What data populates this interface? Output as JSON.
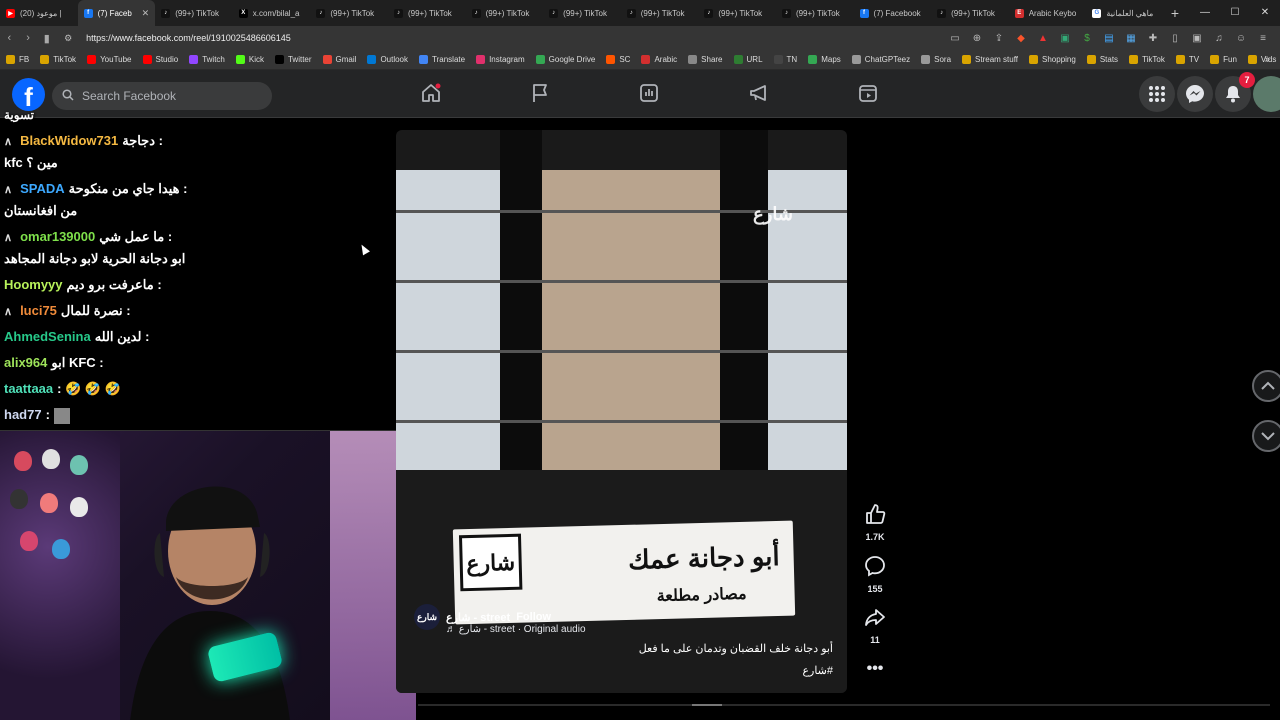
{
  "browser": {
    "tabs": [
      {
        "title": "(20) موعود |",
        "icon": "youtube-icon",
        "color": "#ff0000",
        "glyph": "▶"
      },
      {
        "title": "(7) Faceb",
        "icon": "facebook-icon",
        "color": "#1877f2",
        "glyph": "f",
        "active": true
      },
      {
        "title": "(99+) TikTok",
        "icon": "tiktok-icon",
        "color": "#111111",
        "glyph": "♪"
      },
      {
        "title": "x.com/bilal_a",
        "icon": "x-icon",
        "color": "#000000",
        "glyph": "X"
      },
      {
        "title": "(99+) TikTok",
        "icon": "tiktok-icon",
        "color": "#111111",
        "glyph": "♪"
      },
      {
        "title": "(99+) TikTok",
        "icon": "tiktok-icon",
        "color": "#111111",
        "glyph": "♪"
      },
      {
        "title": "(99+) TikTok",
        "icon": "tiktok-icon",
        "color": "#111111",
        "glyph": "♪"
      },
      {
        "title": "(99+) TikTok",
        "icon": "tiktok-icon",
        "color": "#111111",
        "glyph": "♪"
      },
      {
        "title": "(99+) TikTok",
        "icon": "tiktok-icon",
        "color": "#111111",
        "glyph": "♪"
      },
      {
        "title": "(99+) TikTok",
        "icon": "tiktok-icon",
        "color": "#111111",
        "glyph": "♪"
      },
      {
        "title": "(99+) TikTok",
        "icon": "tiktok-icon",
        "color": "#111111",
        "glyph": "♪"
      },
      {
        "title": "(7) Facebook",
        "icon": "facebook-icon",
        "color": "#1877f2",
        "glyph": "f"
      },
      {
        "title": "(99+) TikTok",
        "icon": "tiktok-icon",
        "color": "#111111",
        "glyph": "♪"
      },
      {
        "title": "Arabic Keybo",
        "icon": "arabic-keyboard-icon",
        "color": "#d32f2f",
        "glyph": "E"
      },
      {
        "title": "ماهي العلمانية",
        "icon": "google-icon",
        "color": "#ffffff",
        "glyph": "G"
      }
    ],
    "url": "https://www.facebook.com/reel/1910025486606145",
    "bookmarks": [
      {
        "label": "FB",
        "icon": "folder-icon",
        "color": "#d9a400"
      },
      {
        "label": "TikTok",
        "icon": "folder-icon",
        "color": "#d9a400"
      },
      {
        "label": "YouTube",
        "icon": "youtube-icon",
        "color": "#ff0000"
      },
      {
        "label": "Studio",
        "icon": "youtube-studio-icon",
        "color": "#ff0000"
      },
      {
        "label": "Twitch",
        "icon": "twitch-icon",
        "color": "#9146ff"
      },
      {
        "label": "Kick",
        "icon": "kick-icon",
        "color": "#53fc18"
      },
      {
        "label": "Twitter",
        "icon": "x-icon",
        "color": "#000000"
      },
      {
        "label": "Gmail",
        "icon": "gmail-icon",
        "color": "#ea4335"
      },
      {
        "label": "Outlook",
        "icon": "outlook-icon",
        "color": "#0078d4"
      },
      {
        "label": "Translate",
        "icon": "translate-icon",
        "color": "#4285f4"
      },
      {
        "label": "Instagram",
        "icon": "instagram-icon",
        "color": "#e1306c"
      },
      {
        "label": "Google Drive",
        "icon": "drive-icon",
        "color": "#34a853"
      },
      {
        "label": "SC",
        "icon": "sc-icon",
        "color": "#ff5500"
      },
      {
        "label": "Arabic",
        "icon": "arabic-icon",
        "color": "#d32f2f"
      },
      {
        "label": "Share",
        "icon": "share-icon",
        "color": "#888888"
      },
      {
        "label": "URL",
        "icon": "url-icon",
        "color": "#2e7d32"
      },
      {
        "label": "TN",
        "icon": "tn-icon",
        "color": "#444444"
      },
      {
        "label": "Maps",
        "icon": "maps-icon",
        "color": "#34a853"
      },
      {
        "label": "ChatGPTeez",
        "icon": "chatgpt-icon",
        "color": "#999999"
      },
      {
        "label": "Sora",
        "icon": "sora-icon",
        "color": "#999999"
      },
      {
        "label": "Stream stuff",
        "icon": "folder-icon",
        "color": "#d9a400"
      },
      {
        "label": "Shopping",
        "icon": "folder-icon",
        "color": "#d9a400"
      },
      {
        "label": "Stats",
        "icon": "folder-icon",
        "color": "#d9a400"
      },
      {
        "label": "TikTok",
        "icon": "folder-icon",
        "color": "#d9a400"
      },
      {
        "label": "TV",
        "icon": "folder-icon",
        "color": "#d9a400"
      },
      {
        "label": "Fun",
        "icon": "folder-icon",
        "color": "#d9a400"
      },
      {
        "label": "Vids",
        "icon": "folder-icon",
        "color": "#d9a400"
      }
    ]
  },
  "facebook": {
    "search_placeholder": "Search Facebook",
    "notification_count": "7",
    "accent": "#0866ff"
  },
  "chat": {
    "top_fragment": "تسوية",
    "lines": [
      {
        "badge": "∧",
        "user": "BlackWidow731",
        "color": "#f5b942",
        "msg": "دجاجة :",
        "cont": "مين ؟ kfc"
      },
      {
        "badge": "∧",
        "user": "SPADA",
        "color": "#3da9ff",
        "msg": "هيدا جاي من منكوحة :",
        "cont": "من افغانستان"
      },
      {
        "badge": "∧",
        "user": "omar139000",
        "color": "#7ee04b",
        "msg": "ما عمل شي :",
        "cont": "ابو دجانة الحرية لابو دجانة المجاهد"
      },
      {
        "badge": "",
        "user": "Hoomyyy",
        "color": "#b8f25a",
        "msg": "ماعرفت برو ديم :",
        "cont": ""
      },
      {
        "badge": "∧",
        "user": "luci75",
        "color": "#f08b3a",
        "msg": "نصرة للمال :",
        "cont": ""
      },
      {
        "badge": "",
        "user": "AhmedSenina",
        "color": "#27c98a",
        "msg": "لدين الله :",
        "cont": ""
      },
      {
        "badge": "",
        "user": "alix964",
        "color": "#9ee35a",
        "msg": "ابو KFC :",
        "cont": ""
      },
      {
        "badge": "",
        "user": "taattaaa",
        "color": "#4fe0b8",
        "msg": ": 🤣 🤣 🤣",
        "cont": ""
      },
      {
        "badge": "",
        "user": "had77",
        "color": "#cfd8f0",
        "msg": ":",
        "cont": ""
      }
    ]
  },
  "reel": {
    "watermark": "شارع",
    "logo_text": "شارع",
    "headline": "أبو دجانة عمك",
    "subheadline": "مصادر مطلعة",
    "author": "شارع - street",
    "follow": "Follow",
    "audio": "♬ شارع - street · Original audio",
    "avatar_text": "شارع",
    "description": "أبو دجانة خلف القضبان وتدمان على ما فعل",
    "hashtag": "#شارع",
    "likes": "1.7K",
    "comments": "155",
    "shares": "11"
  }
}
